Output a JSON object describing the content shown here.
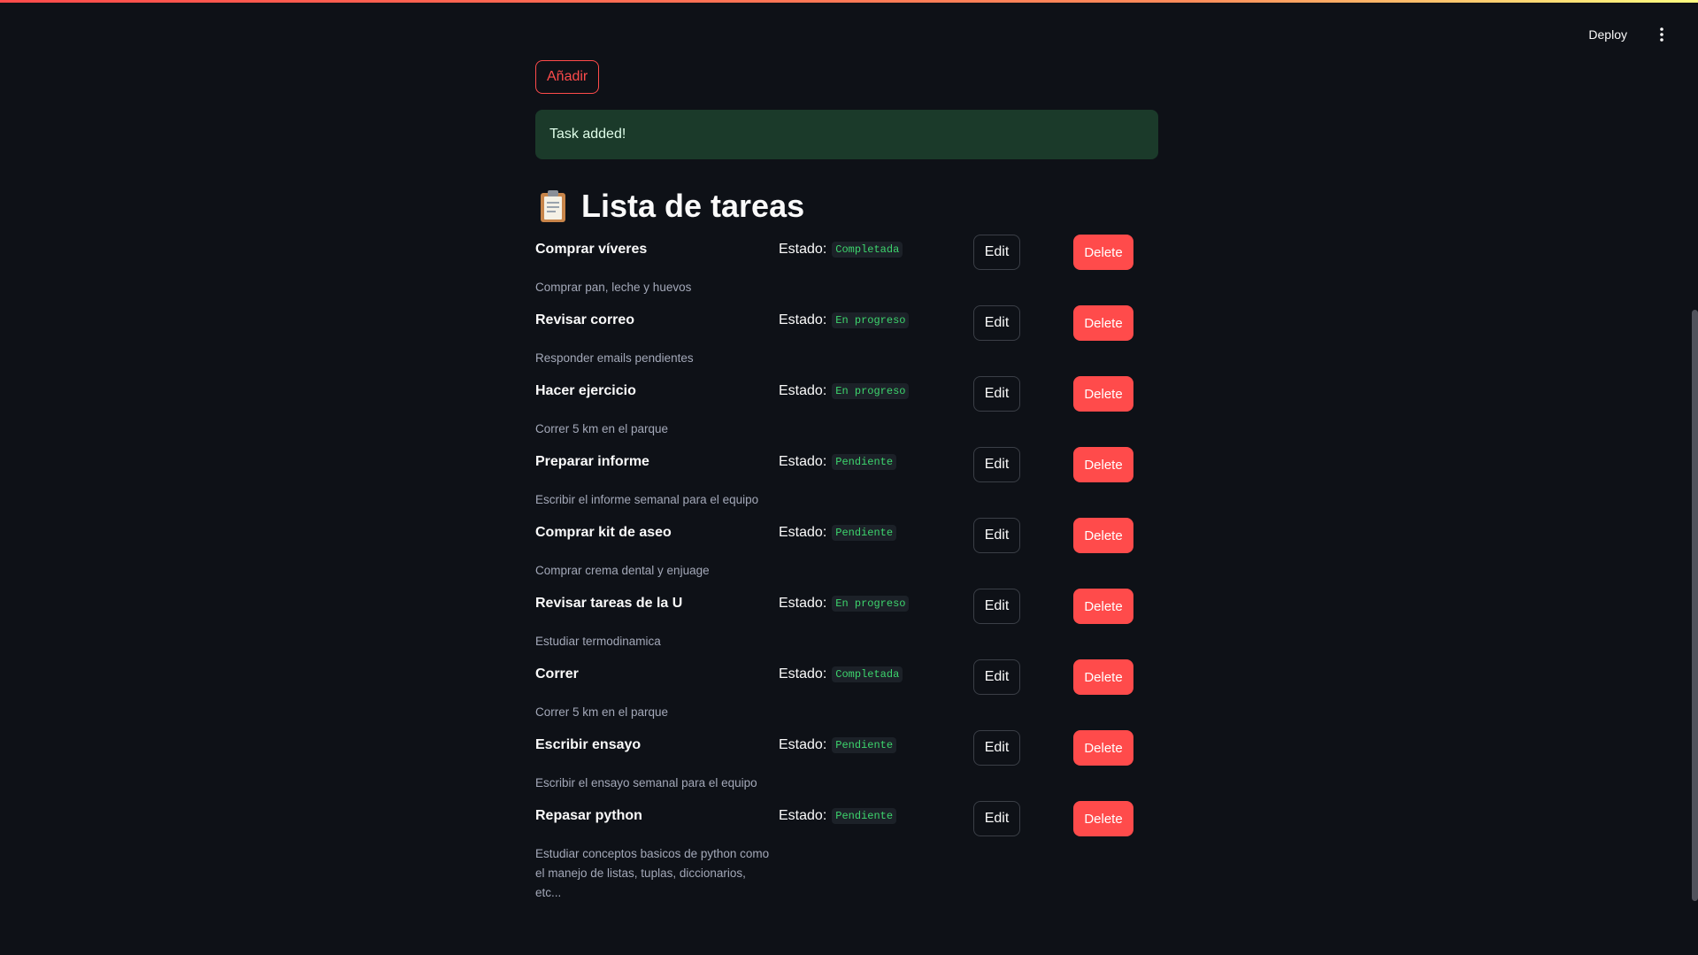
{
  "header": {
    "deploy_label": "Deploy",
    "menu_icon": "vertical-ellipsis-icon"
  },
  "add_button_label": "Añadir",
  "alert": {
    "message": "Task added!",
    "color": "#1b3a2a"
  },
  "title": {
    "emoji": "📋",
    "text": "Lista de tareas"
  },
  "status_label": "Estado:",
  "edit_label": "Edit",
  "delete_label": "Delete",
  "colors": {
    "accent": "#ff4b4b",
    "background": "#0e1117",
    "status_text": "#3dd56d"
  },
  "tasks": [
    {
      "title": "Comprar víveres",
      "status": "Completada",
      "description": "Comprar pan, leche y huevos"
    },
    {
      "title": "Revisar correo",
      "status": "En progreso",
      "description": "Responder emails pendientes"
    },
    {
      "title": "Hacer ejercicio",
      "status": "En progreso",
      "description": "Correr 5 km en el parque"
    },
    {
      "title": "Preparar informe",
      "status": "Pendiente",
      "description": "Escribir el informe semanal para el equipo"
    },
    {
      "title": "Comprar kit de aseo",
      "status": "Pendiente",
      "description": "Comprar crema dental y enjuage"
    },
    {
      "title": "Revisar tareas de la U",
      "status": "En progreso",
      "description": "Estudiar termodinamica"
    },
    {
      "title": "Correr",
      "status": "Completada",
      "description": "Correr 5 km en el parque"
    },
    {
      "title": "Escribir ensayo",
      "status": "Pendiente",
      "description": "Escribir el ensayo semanal para el equipo"
    },
    {
      "title": "Repasar python",
      "status": "Pendiente",
      "description": "Estudiar conceptos basicos de python como el manejo de listas, tuplas, diccionarios, etc..."
    }
  ]
}
